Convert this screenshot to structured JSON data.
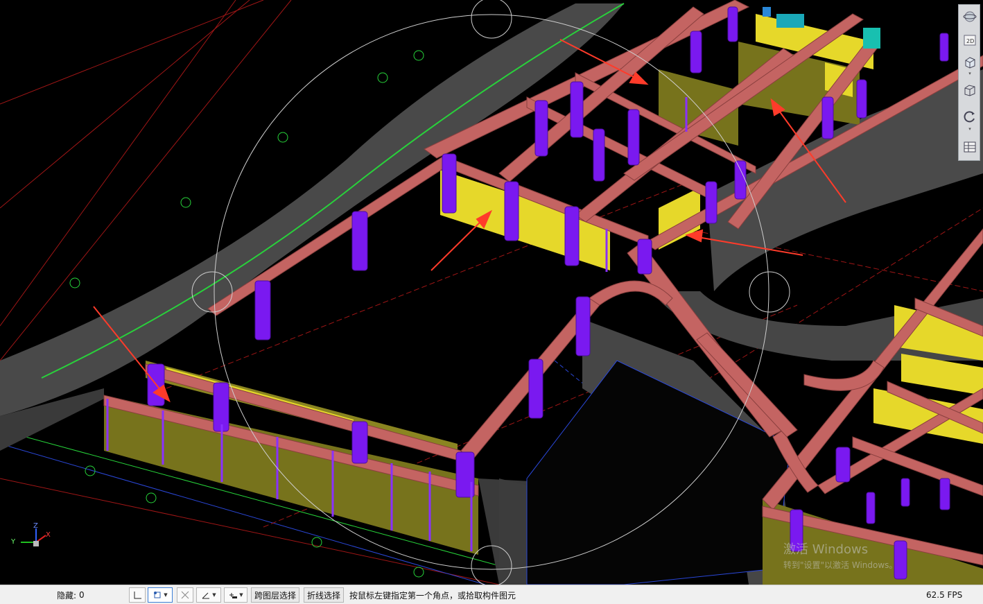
{
  "viewport": {
    "background": "#000000",
    "colors": {
      "wall": "#c46462",
      "column": "#7a19f0",
      "panel_yellow": "#e6d82a",
      "panel_olive": "#77731c",
      "ramp_gray": "#4a4a4a",
      "grid_red": "#b01818",
      "grid_green": "#27d53a",
      "grid_blue": "#2a47d8"
    }
  },
  "nav_toolbar": {
    "items": [
      {
        "name": "orbit-button",
        "icon": "globe-orbit-icon"
      },
      {
        "name": "view-2d-button",
        "icon": "view-2d-icon",
        "label": "2D"
      },
      {
        "name": "view-3d-button",
        "icon": "cube-3d-icon"
      },
      {
        "name": "view-box-button",
        "icon": "cube-outline-icon"
      },
      {
        "name": "rotate-button",
        "icon": "rotate-icon"
      },
      {
        "name": "layer-panel-button",
        "icon": "layer-grid-icon"
      }
    ]
  },
  "axis_indicator": {
    "x": "X",
    "y": "Y",
    "z": "Z"
  },
  "watermark": {
    "title": "激活 Windows",
    "subtitle": "转到\"设置\"以激活 Windows。"
  },
  "statusbar": {
    "hidden_label": "隐藏:",
    "hidden_count": "0",
    "cross_layer_select": "跨图层选择",
    "polyline_select": "折线选择",
    "prompt": "按鼠标左键指定第一个角点，或拾取构件图元",
    "fps": "62.5 FPS"
  }
}
